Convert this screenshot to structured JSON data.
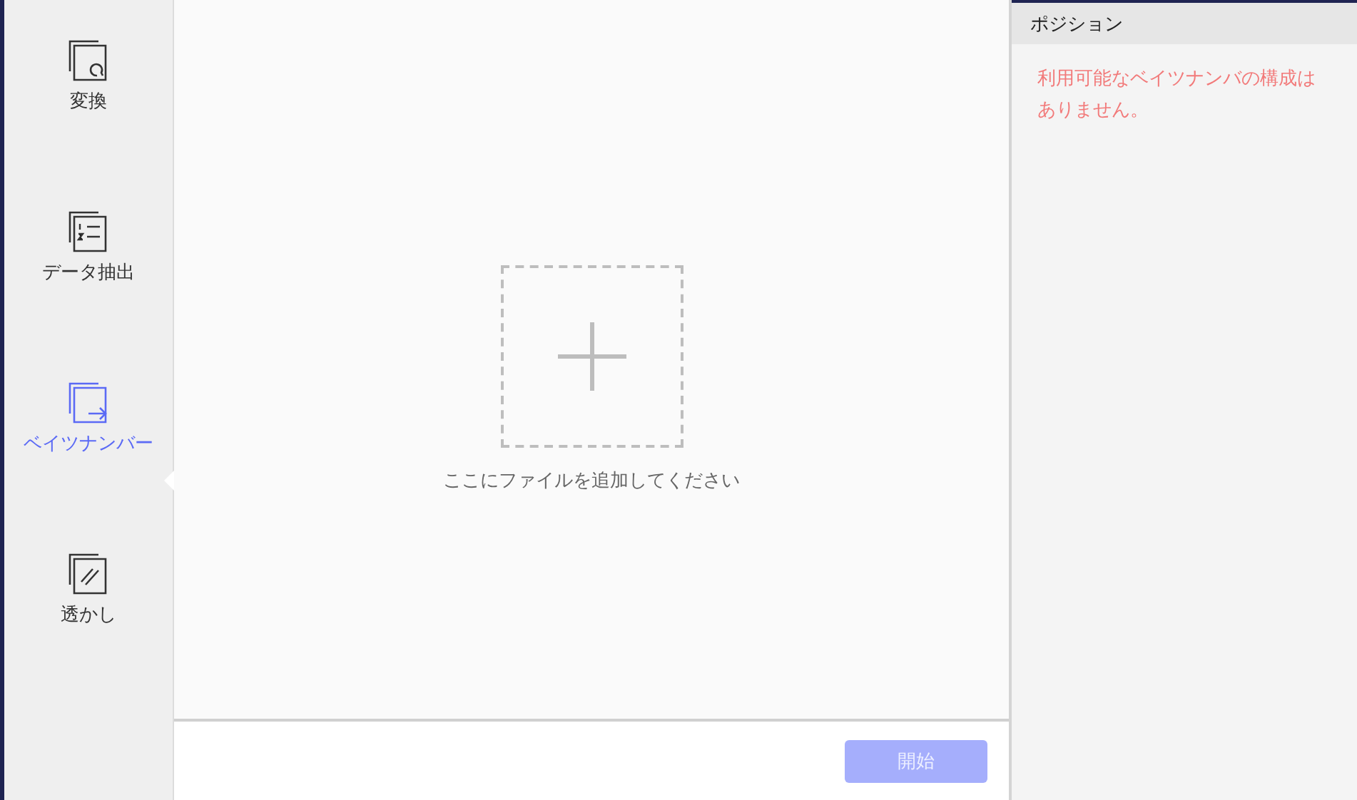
{
  "sidebar": {
    "items": [
      {
        "kind": "convert",
        "label": "変換",
        "selected": false
      },
      {
        "kind": "extract",
        "label": "データ抽出",
        "selected": false
      },
      {
        "kind": "bates",
        "label": "ベイツナンバー",
        "selected": true
      },
      {
        "kind": "watermark",
        "label": "透かし",
        "selected": false
      }
    ]
  },
  "drop_area": {
    "hint": "ここにファイルを追加してください"
  },
  "start_button": {
    "label": "開始",
    "disabled": true
  },
  "position_panel": {
    "title": "ポジション",
    "message": "利用可能なベイツナンバの構成はありません。"
  }
}
